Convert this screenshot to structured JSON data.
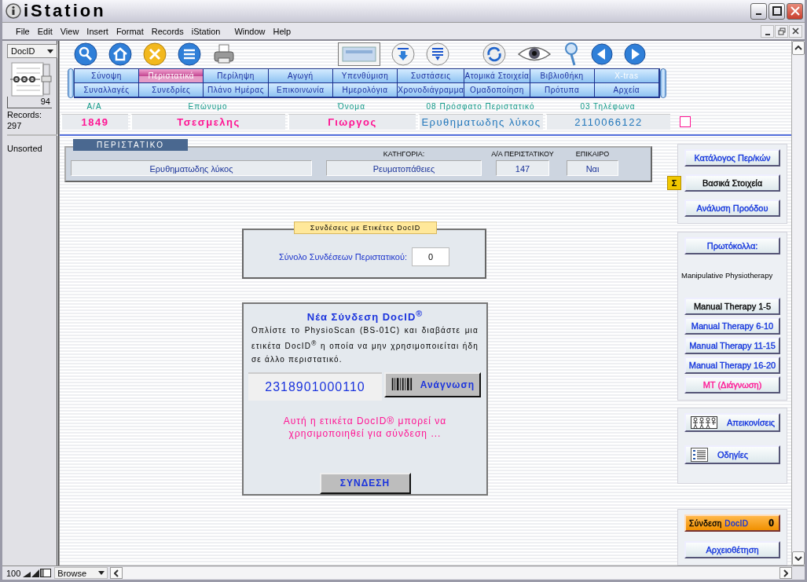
{
  "window": {
    "title": "iStation"
  },
  "menu": [
    "File",
    "Edit",
    "View",
    "Insert",
    "Format",
    "Records",
    "iStation",
    "Window",
    "Help"
  ],
  "sidebar": {
    "layout": "DocID",
    "record_number": "94",
    "records_label": "Records:",
    "records_count": "297",
    "sort_status": "Unsorted"
  },
  "tab_rows": [
    {
      "tabs": [
        {
          "label": "Σύνοψη",
          "selected": false,
          "disabled": false
        },
        {
          "label": "Περιστατικά",
          "selected": true,
          "disabled": false
        },
        {
          "label": "Περίληψη",
          "selected": false,
          "disabled": false
        },
        {
          "label": "Αγωγή",
          "selected": false,
          "disabled": false
        },
        {
          "label": "Υπενθύμιση",
          "selected": false,
          "disabled": false
        },
        {
          "label": "Συστάσεις",
          "selected": false,
          "disabled": false
        },
        {
          "label": "Ατομικά Στοιχεία",
          "selected": false,
          "disabled": false
        },
        {
          "label": "Βιβλιοθήκη",
          "selected": false,
          "disabled": false
        },
        {
          "label": "X-tras",
          "selected": false,
          "disabled": true
        }
      ]
    },
    {
      "tabs": [
        {
          "label": "Συναλλαγές",
          "selected": false,
          "disabled": false
        },
        {
          "label": "Συνεδρίες",
          "selected": false,
          "disabled": false
        },
        {
          "label": "Πλάνο Ημέρας",
          "selected": false,
          "disabled": false
        },
        {
          "label": "Επικοινωνία",
          "selected": false,
          "disabled": false
        },
        {
          "label": "Ημερολόγια",
          "selected": false,
          "disabled": false
        },
        {
          "label": "Χρονοδιάγραμμα",
          "selected": false,
          "disabled": false
        },
        {
          "label": "Ομαδοποίηση",
          "selected": false,
          "disabled": false
        },
        {
          "label": "Πρότυπα",
          "selected": false,
          "disabled": false
        },
        {
          "label": "Αρχεία",
          "selected": false,
          "disabled": false
        }
      ]
    }
  ],
  "patient": {
    "fields": [
      {
        "label": "Α/Α",
        "value": "1849",
        "color": "#ff1493"
      },
      {
        "label": "Επώνυμο",
        "value": "Τσεσμελης",
        "color": "#ff1493"
      },
      {
        "label": "Όνομα",
        "value": "Γιωργος",
        "color": "#ff1493"
      },
      {
        "label": "08  Πρόσφατο Περιστατικό",
        "value": "Ερυθηματωδης λύκος",
        "color": "#2277bb"
      },
      {
        "label": "03  Τηλέφωνα",
        "value": "2110066122",
        "color": "#2277bb"
      }
    ],
    "checked": false
  },
  "case_panel": {
    "tab": "ΠΕΡΙΣΤΑΤΙΚΟ",
    "diagnosis": "Ερυθηματωδης λύκος",
    "fields": [
      {
        "label": "ΚΑΤΗΓΟΡΙΑ:",
        "value": "Ρευματοπάθειες"
      },
      {
        "label": "Α/Α ΠΕΡΙΣΤΑΤΙΚΟΥ",
        "value": "147"
      },
      {
        "label": "ΕΠΙΚΑΙΡΟ",
        "value": "Ναι"
      }
    ]
  },
  "links_panel": {
    "title": "Συνδέσεις με Ετικέτες DocID",
    "label": "Σύνολο Συνδέσεων Περιστατικού:",
    "value": "0"
  },
  "new_link_panel": {
    "title": "Νέα Σύνδεση DocID$^{®}$",
    "instructions": "Οπλίστε το PhysioScan (BS-01C) και διαβάστε μια ετικέτα DocID$^{®}$ η οποία να μην χρησιμοποιείται ήδη σε άλλο περιστατικό.",
    "barcode": "2318901000110",
    "read_button": "Ανάγνωση",
    "message": "Αυτή η ετικέτα DocID® μπορεί να χρησιμοποιηθεί για σύνδεση ...",
    "link_button": "ΣΥΝΔΕΣΗ"
  },
  "right_panel": {
    "groups": [
      {
        "items": [
          {
            "kind": "button",
            "label": "Κατάλογος Περ/κών",
            "color": "#1133dd"
          },
          {
            "kind": "button",
            "label": "Βασικά Στοιχεία",
            "color": "#000000",
            "badge": "Σ"
          },
          {
            "kind": "button",
            "label": "Ανάλυση Προόδου",
            "color": "#1133dd"
          }
        ]
      },
      {
        "items": [
          {
            "kind": "button",
            "label": "Πρωτόκολλα:",
            "color": "#1133dd"
          },
          {
            "kind": "note",
            "label": "Manipulative Physiotherapy"
          },
          {
            "kind": "button",
            "label": "Manual Therapy 1-5",
            "color": "#000000"
          },
          {
            "kind": "button",
            "label": "Manual Therapy 6-10",
            "color": "#1133dd"
          },
          {
            "kind": "button",
            "label": "Manual Therapy 11-15",
            "color": "#1133dd"
          },
          {
            "kind": "button",
            "label": "Manual Therapy 16-20",
            "color": "#1133dd"
          },
          {
            "kind": "button",
            "label": "MT (Διάγνωση)",
            "color": "#ff1493"
          }
        ]
      },
      {
        "items": [
          {
            "kind": "people",
            "label": "Απεικονίσεις",
            "color": "#1133dd"
          },
          {
            "kind": "list",
            "label": "Οδηγίες",
            "color": "#1133dd"
          }
        ]
      },
      {
        "items": [
          {
            "kind": "counter",
            "label": "Σύνδεση",
            "label_2": "DocID",
            "count": "0"
          },
          {
            "kind": "button",
            "label": "Αρχειοθέτηση",
            "color": "#1133dd"
          }
        ]
      }
    ]
  },
  "status_bar": {
    "zoom": "100",
    "mode": "Browse"
  }
}
